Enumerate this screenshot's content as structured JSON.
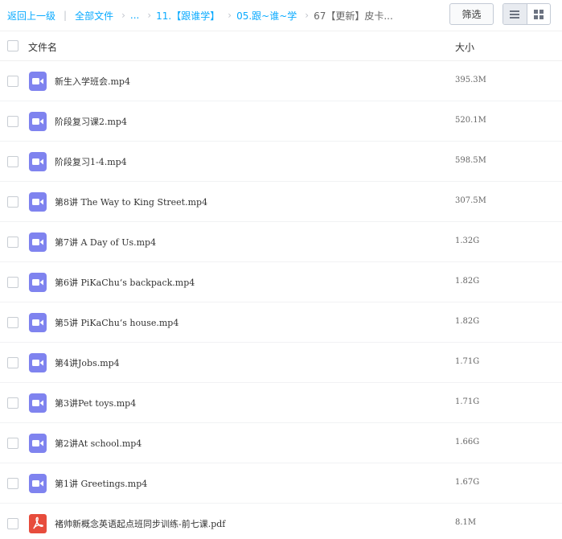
{
  "breadcrumb": {
    "back": "返回上一级",
    "separator": "|",
    "root": "全部文件",
    "ellipsis": "...",
    "level1": "11.【跟谁学】",
    "level2": "05.跟~谁~学",
    "current": "67【更新】皮卡..."
  },
  "toolbar": {
    "filter_label": "筛选"
  },
  "table": {
    "col_name": "文件名",
    "col_size": "大小"
  },
  "colors": {
    "link": "#09aaff",
    "video_icon": "#7f83ef",
    "pdf_icon": "#e74c3c"
  },
  "files": [
    {
      "name": "新生入学班会.mp4",
      "size": "395.3M",
      "icon": "video-icon"
    },
    {
      "name": "阶段复习课2.mp4",
      "size": "520.1M",
      "icon": "video-icon"
    },
    {
      "name": "阶段复习1-4.mp4",
      "size": "598.5M",
      "icon": "video-icon"
    },
    {
      "name": "第8讲 The Way to King Street.mp4",
      "size": "307.5M",
      "icon": "video-icon"
    },
    {
      "name": "第7讲 A Day of Us.mp4",
      "size": "1.32G",
      "icon": "video-icon"
    },
    {
      "name": "第6讲 PiKaChu‘s backpack.mp4",
      "size": "1.82G",
      "icon": "video-icon"
    },
    {
      "name": "第5讲 PiKaChu‘s house.mp4",
      "size": "1.82G",
      "icon": "video-icon"
    },
    {
      "name": "第4讲Jobs.mp4",
      "size": "1.71G",
      "icon": "video-icon"
    },
    {
      "name": "第3讲Pet toys.mp4",
      "size": "1.71G",
      "icon": "video-icon"
    },
    {
      "name": "第2讲At school.mp4",
      "size": "1.66G",
      "icon": "video-icon"
    },
    {
      "name": "第1讲 Greetings.mp4",
      "size": "1.67G",
      "icon": "video-icon"
    },
    {
      "name": "褚帅新概念英语起点班同步训练-前七课.pdf",
      "size": "8.1M",
      "icon": "pdf-icon"
    }
  ]
}
